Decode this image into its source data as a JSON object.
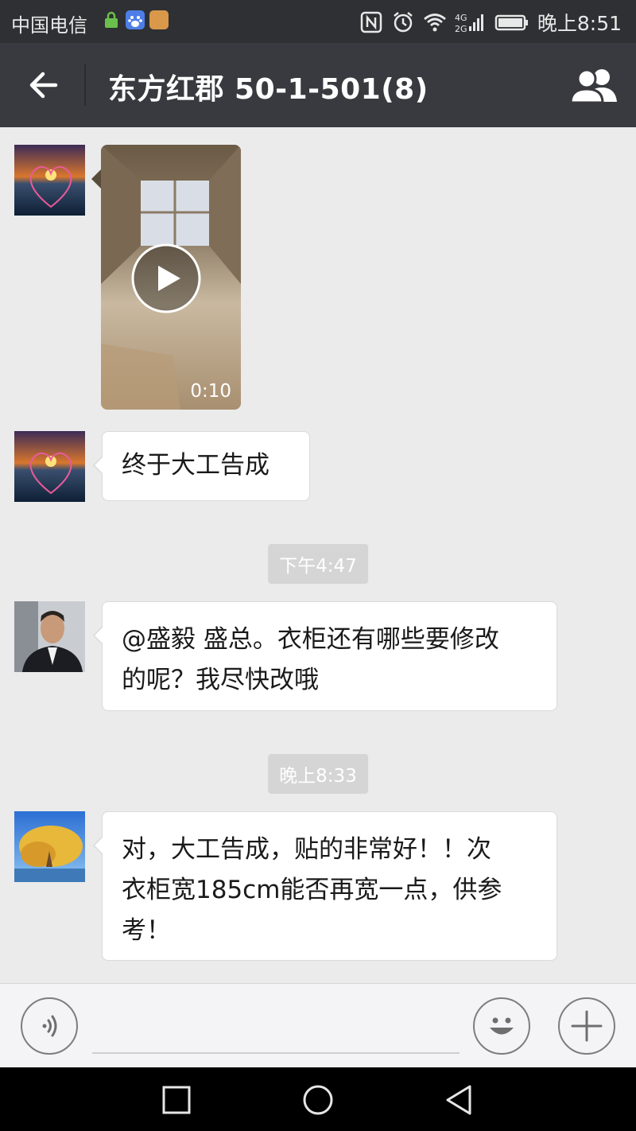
{
  "status_bar": {
    "carrier": "中国电信",
    "time": "晚上8:51",
    "icons": [
      "lock-app-icon",
      "baidu-icon",
      "orange-app-icon",
      "nfc-icon",
      "alarm-icon",
      "wifi-icon",
      "signal-4g-2g-icon",
      "battery-icon"
    ]
  },
  "header": {
    "title": "东方红郡 50-1-501(8)",
    "back_icon": "arrow-left-icon",
    "group_icon": "group-members-icon"
  },
  "messages": [
    {
      "type": "video",
      "duration": "0:10"
    },
    {
      "type": "text",
      "text": "终于大工告成"
    },
    {
      "type": "timestamp",
      "text": "下午4:47"
    },
    {
      "type": "text",
      "lines": [
        "@盛毅 盛总。衣柜还有哪些要修改",
        "的呢？我尽快改哦"
      ]
    },
    {
      "type": "timestamp",
      "text": "晚上8:33"
    },
    {
      "type": "text",
      "lines": [
        "对，大工告成，贴的非常好！！次",
        "衣柜宽185cm能否再宽一点，供参",
        "考！"
      ]
    }
  ],
  "input_bar": {
    "value": "",
    "icons": [
      "voice-icon",
      "emoji-icon",
      "plus-icon"
    ]
  },
  "nav_bar": {
    "icons": [
      "recent-apps-icon",
      "home-icon",
      "back-triangle-icon"
    ]
  },
  "colors": {
    "status_bar_bg": "#2e3033",
    "title_bar_bg": "#393a3f",
    "chat_bg": "#ebebeb",
    "bubble_bg": "#ffffff",
    "timestamp_bg": "#d5d5d5"
  }
}
